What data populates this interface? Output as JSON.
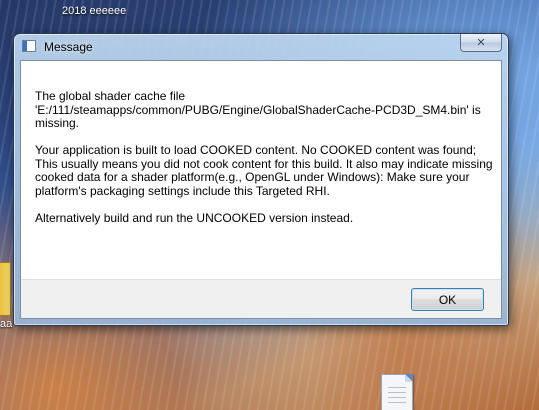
{
  "desktop": {
    "top_label": "2018 eeeeee",
    "left_label": "aa",
    "file_icon": "document-icon",
    "folder_icon": "folder-icon"
  },
  "window": {
    "title": "Message",
    "title_icon": "application-icon",
    "close_icon": "close-icon",
    "close_glyph": "✕"
  },
  "message": {
    "paragraphs": [
      "The global shader cache file 'E:/111/steamapps/common/PUBG/Engine/GlobalShaderCache-PCD3D_SM4.bin' is missing.",
      "Your application is built to load COOKED content. No COOKED content was found; This usually means you did not cook content for this build. It also may indicate missing cooked data for a shader platform(e.g., OpenGL under Windows): Make sure your platform's packaging settings include this Targeted RHI.",
      "Alternatively build and run the UNCOOKED version instead."
    ]
  },
  "buttons": {
    "ok_label": "OK"
  },
  "colors": {
    "dialog_background": "#ffffff",
    "button_bar_background": "#f0f0f0",
    "default_button_border": "#3c7fb1"
  }
}
